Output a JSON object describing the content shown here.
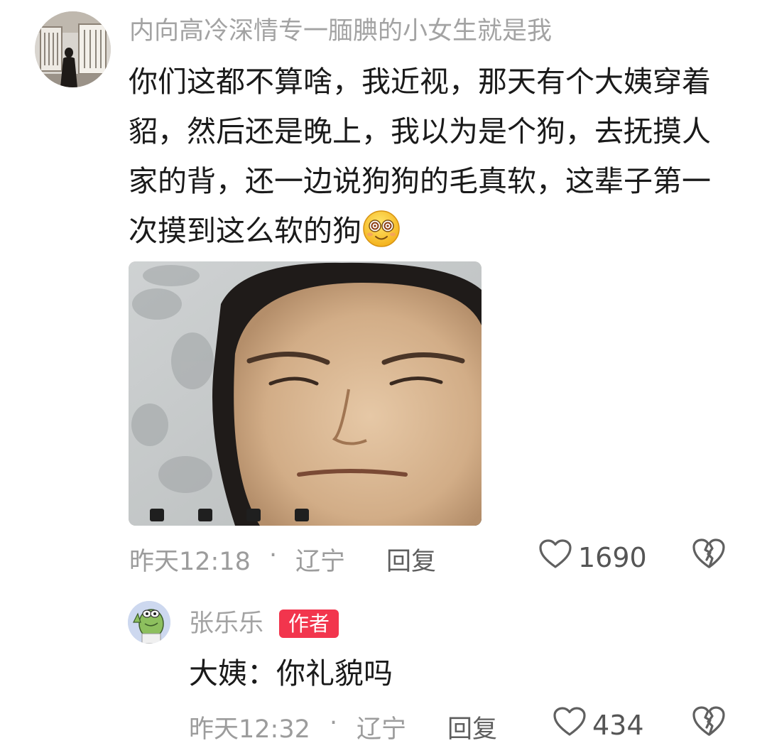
{
  "comment": {
    "username": "内向高冷深情专一腼腆的小女生就是我",
    "text": "你们这都不算啥，我近视，那天有个大姨穿着貂，然后还是晚上，我以为是个狗，去抚摸人家的背，还一边说狗狗的毛真软，这辈子第一次摸到这么软的狗",
    "emoji_icon": "dizzy-eyes-smile-emoji",
    "time": "昨天12:18",
    "separator": "·",
    "location": "辽宁",
    "reply_label": "回复",
    "like_count": "1690",
    "like_icon": "heart-outline-icon",
    "dislike_icon": "broken-heart-icon"
  },
  "reply": {
    "username": "张乐乐",
    "badge": "作者",
    "text": "大姨：你礼貌吗",
    "time": "昨天12:32",
    "separator": "·",
    "location": "辽宁",
    "reply_label": "回复",
    "like_count": "434",
    "like_icon": "heart-outline-icon",
    "dislike_icon": "broken-heart-icon"
  },
  "colors": {
    "badge_bg": "#f2354d",
    "username": "#a3a3a3",
    "meta": "#9c9c9c",
    "text": "#1a1a1a"
  }
}
